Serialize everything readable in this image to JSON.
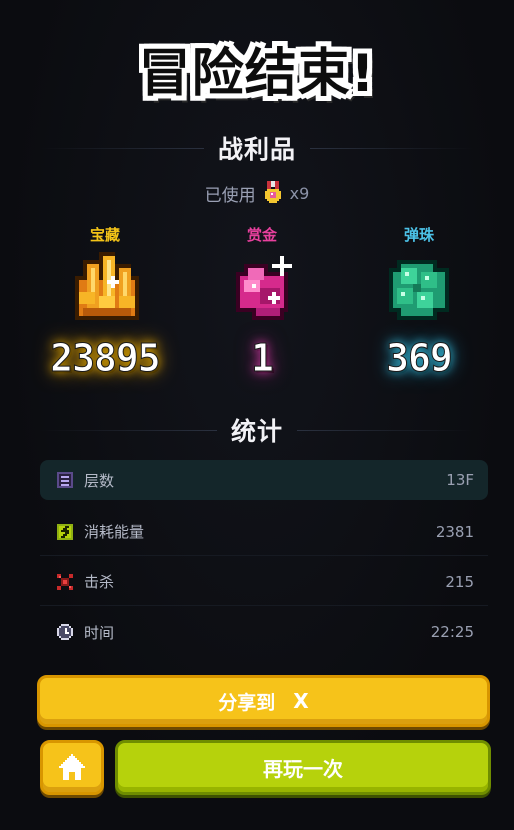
{
  "title": "冒险结束!",
  "loot": {
    "header": "战利品",
    "used_label": "已使用",
    "used_count": "x9",
    "items": [
      {
        "label": "宝藏",
        "value": "23895",
        "color": "#f3c318",
        "icon": "treasure-coins-icon"
      },
      {
        "label": "赏金",
        "value": "1",
        "color": "#e8409e",
        "icon": "bounty-gem-icon"
      },
      {
        "label": "弹珠",
        "value": "369",
        "color": "#4cc2e8",
        "icon": "marbles-icon"
      }
    ]
  },
  "stats": {
    "header": "统计",
    "rows": [
      {
        "label": "层数",
        "value": "13F",
        "icon": "floor-icon"
      },
      {
        "label": "消耗能量",
        "value": "2381",
        "icon": "energy-icon"
      },
      {
        "label": "击杀",
        "value": "215",
        "icon": "kill-icon"
      },
      {
        "label": "时间",
        "value": "22:25",
        "icon": "clock-icon"
      }
    ]
  },
  "buttons": {
    "share_label": "分享到",
    "share_target": "X",
    "home_icon": "home-icon",
    "again_label": "再玩一次"
  },
  "colors": {
    "gold_button": "#f6c31a",
    "green_button": "#b6d20c",
    "background": "#0b0c10",
    "highlight_row": "#14262a"
  }
}
